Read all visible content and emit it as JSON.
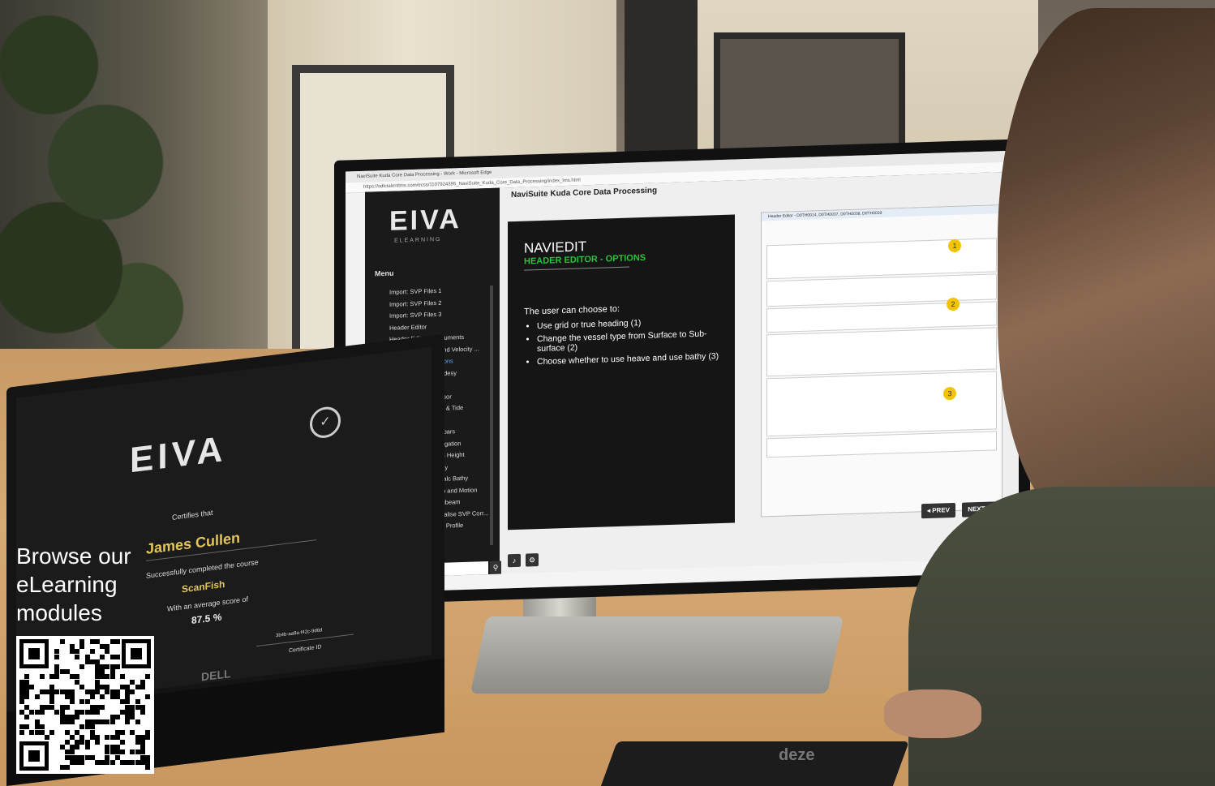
{
  "promo": {
    "headline_line1": "Browse our",
    "headline_line2": "eLearning",
    "headline_line3": "modules"
  },
  "browser": {
    "window_title": "NaviSuite Kuda Core Data Processing - Work - Microsoft Edge",
    "url": "https://sdlctalentlms.com/ecss/1107924395_NaviSuite_Kuda_Core_Data_Processing/index_lms.html"
  },
  "elearning_app": {
    "logo": "EIVA",
    "logo_sub": "ELEARNING",
    "course_title": "NaviSuite Kuda Core Data Processing",
    "menu_label": "Menu",
    "menu_items": [
      "Import: SVP Files 1",
      "Import: SVP Files 2",
      "Import: SVP Files 3",
      "Header Editor",
      "Header Editor - Instruments",
      "Header Editor - Sound Velocity ...",
      "Header Editor - Options",
      "Header Editor - Geodesy",
      "Header Editor - Tide",
      "Header Editor - Sensor",
      "Header Editor - SVP & Tide",
      "Header Editor",
      "Header Editor - Toolbars",
      "Header Editor - Navigation",
      "Header Editor - GPS Height",
      "Header Editor - Bathy",
      "Header Editor - Recalc Bathy",
      "Header Editor - Gyro and Motion",
      "Header Editor - Multibeam",
      "Header Editor - Visualise SVP Corr...",
      "Header Editor - SVP Profile"
    ],
    "active_menu_index": 6,
    "slide": {
      "title": "NAVIEDIT",
      "subtitle": "HEADER EDITOR - OPTIONS",
      "intro": "The user can choose to:",
      "bullets": [
        "Use grid or true heading (1)",
        "Change the vessel type from Surface to Sub-surface (2)",
        "Choose whether to use heave and use bathy (3)"
      ]
    },
    "screenshot_window_title": "Header Editor - D0TH0014, D0TH0037, D0TH0038, D0TH0039",
    "badges": [
      "1",
      "2",
      "3"
    ],
    "prev_label": "◂ PREV",
    "next_label": "NEXT ▸",
    "search_icon": "search-icon",
    "audio_icon": "speaker-icon",
    "settings_icon": "gear-icon"
  },
  "certificate": {
    "logo": "EIVA",
    "certifies": "Certifies that",
    "name": "James Cullen",
    "completed": "Successfully completed the course",
    "course": "ScanFish",
    "score_label": "With an average score of",
    "score": "87.5 %",
    "certificate_id_value": "3b4b-aa8a-f42c-9d6d",
    "certificate_id_label": "Certificate ID",
    "laptop_brand": "DELL"
  },
  "mousepad_brand": "deze"
}
